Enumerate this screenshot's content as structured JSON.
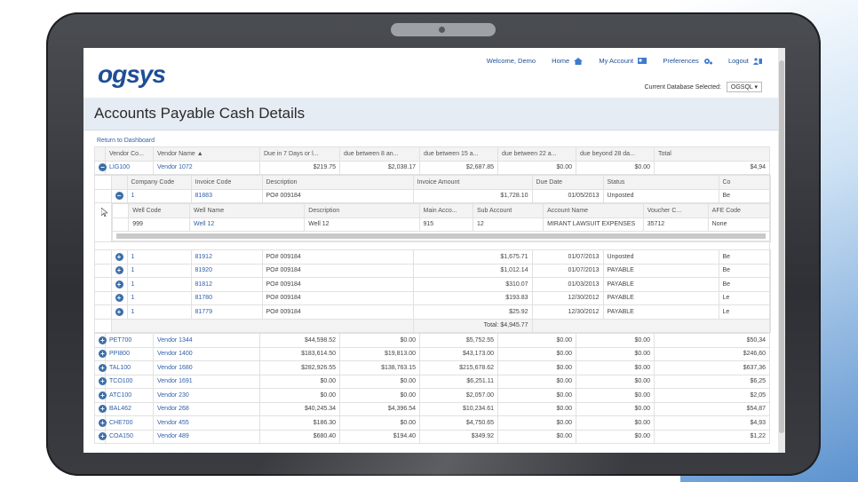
{
  "nav": {
    "welcome": "Welcome, Demo",
    "home": "Home",
    "my_account": "My Account",
    "preferences": "Preferences",
    "logout": "Logout",
    "db_label": "Current Database Selected:",
    "db_value": "OGSQL"
  },
  "logo": "ogsys",
  "page_title": "Accounts Payable Cash Details",
  "return_link": "Return to Dashboard",
  "main_headers": [
    "Vendor Co...",
    "Vendor Name ▲",
    "Due in 7 Days or l...",
    "due between 8 an...",
    "due between 15 a...",
    "due between 22 a...",
    "due beyond 28 da...",
    "Total"
  ],
  "expanded_vendor": {
    "code": "LIG100",
    "name": "Vendor 1072",
    "v1": "$219.75",
    "v2": "$2,038.17",
    "v3": "$2,687.85",
    "v4": "$0.00",
    "v5": "$0.00",
    "total": "$4,94"
  },
  "invoice_headers": [
    "Company Code",
    "Invoice Code",
    "Description",
    "Invoice Amount",
    "Due Date",
    "Status",
    "Co"
  ],
  "expanded_invoice": {
    "company": "1",
    "code": "81883",
    "desc": "PO# 009184",
    "amount": "$1,728.10",
    "due": "01/05/2013",
    "status": "Unposted",
    "co": "Be"
  },
  "well_headers": [
    "Well Code",
    "Well Name",
    "Description",
    "Main Acco...",
    "Sub Account",
    "Account Name",
    "Voucher C...",
    "AFE Code"
  ],
  "well_row": {
    "code": "999",
    "name": "Well 12",
    "desc": "Well 12",
    "main": "915",
    "sub": "12",
    "account": "MIRANT LAWSUIT EXPENSES",
    "voucher": "35712",
    "afe": "None"
  },
  "invoices": [
    {
      "company": "1",
      "code": "81912",
      "desc": "PO# 009184",
      "amount": "$1,675.71",
      "due": "01/07/2013",
      "status": "Unposted",
      "co": "Be"
    },
    {
      "company": "1",
      "code": "81920",
      "desc": "PO# 009184",
      "amount": "$1,012.14",
      "due": "01/07/2013",
      "status": "PAYABLE",
      "co": "Be"
    },
    {
      "company": "1",
      "code": "81812",
      "desc": "PO# 009184",
      "amount": "$310.07",
      "due": "01/03/2013",
      "status": "PAYABLE",
      "co": "Be"
    },
    {
      "company": "1",
      "code": "81780",
      "desc": "PO# 009184",
      "amount": "$193.83",
      "due": "12/30/2012",
      "status": "PAYABLE",
      "co": "Le"
    },
    {
      "company": "1",
      "code": "81779",
      "desc": "PO# 009184",
      "amount": "$25.92",
      "due": "12/30/2012",
      "status": "PAYABLE",
      "co": "Le"
    }
  ],
  "invoice_total": "Total: $4,945.77",
  "vendors": [
    {
      "code": "PET700",
      "name": "Vendor 1344",
      "v1": "$44,598.52",
      "v2": "$0.00",
      "v3": "$5,752.55",
      "v4": "$0.00",
      "v5": "$0.00",
      "total": "$50,34"
    },
    {
      "code": "PPI800",
      "name": "Vendor 1400",
      "v1": "$183,614.50",
      "v2": "$19,813.00",
      "v3": "$43,173.00",
      "v4": "$0.00",
      "v5": "$0.00",
      "total": "$246,60"
    },
    {
      "code": "TAL100",
      "name": "Vendor 1680",
      "v1": "$282,926.55",
      "v2": "$138,763.15",
      "v3": "$215,678.62",
      "v4": "$0.00",
      "v5": "$0.00",
      "total": "$637,36"
    },
    {
      "code": "TCO100",
      "name": "Vendor 1691",
      "v1": "$0.00",
      "v2": "$0.00",
      "v3": "$6,251.11",
      "v4": "$0.00",
      "v5": "$0.00",
      "total": "$6,25"
    },
    {
      "code": "ATC100",
      "name": "Vendor 230",
      "v1": "$0.00",
      "v2": "$0.00",
      "v3": "$2,057.00",
      "v4": "$0.00",
      "v5": "$0.00",
      "total": "$2,05"
    },
    {
      "code": "BAL462",
      "name": "Vendor 268",
      "v1": "$40,245.34",
      "v2": "$4,396.54",
      "v3": "$10,234.61",
      "v4": "$0.00",
      "v5": "$0.00",
      "total": "$54,87"
    },
    {
      "code": "CHE700",
      "name": "Vendor 455",
      "v1": "$186.30",
      "v2": "$0.00",
      "v3": "$4,750.65",
      "v4": "$0.00",
      "v5": "$0.00",
      "total": "$4,93"
    },
    {
      "code": "COA150",
      "name": "Vendor 489",
      "v1": "$680.40",
      "v2": "$194.40",
      "v3": "$349.92",
      "v4": "$0.00",
      "v5": "$0.00",
      "total": "$1,22"
    }
  ]
}
